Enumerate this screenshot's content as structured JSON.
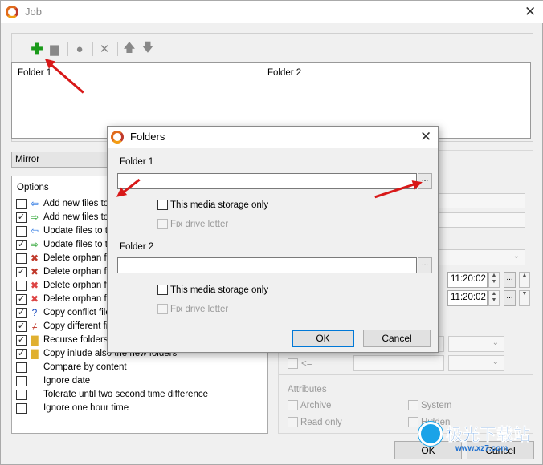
{
  "window": {
    "title": "Job"
  },
  "toolbar": {
    "add_icon": "plus-icon",
    "edit_icon": "edit-icon",
    "copy_icon": "copy-icon",
    "delete_icon": "x-icon",
    "up_icon": "arrow-up-icon",
    "down_icon": "arrow-down-icon"
  },
  "folder_list": {
    "columns": [
      "Folder 1",
      "Folder 2"
    ]
  },
  "sync_mode": {
    "value": "Mirror"
  },
  "options": {
    "title": "Options",
    "items": [
      {
        "label": "Add new files to th",
        "checked": false
      },
      {
        "label": "Add new files to th",
        "checked": true
      },
      {
        "label": "Update files to the",
        "checked": false
      },
      {
        "label": "Update files to the",
        "checked": true
      },
      {
        "label": "Delete orphan file",
        "checked": false
      },
      {
        "label": "Delete orphan file",
        "checked": true
      },
      {
        "label": "Delete orphan fol",
        "checked": false
      },
      {
        "label": "Delete orphan fol",
        "checked": true
      },
      {
        "label": "Copy conflict files",
        "checked": true
      },
      {
        "label": "Copy different file",
        "checked": true
      },
      {
        "label": "Recurse folders",
        "checked": true
      },
      {
        "label": "Copy inlude also the new folders",
        "checked": true
      },
      {
        "label": "Compare by content",
        "checked": false
      },
      {
        "label": "Ignore date",
        "checked": false
      },
      {
        "label": "Tolerate until two second time difference",
        "checked": false
      },
      {
        "label": "Ignore one hour time",
        "checked": false
      }
    ]
  },
  "filters": {
    "time1": "11:20:02",
    "time2": "11:20:02",
    "le_label": "<=",
    "attributes_title": "Attributes",
    "archive": "Archive",
    "system": "System",
    "read_only": "Read only",
    "hidden": "Hidden"
  },
  "main_buttons": {
    "ok": "OK",
    "cancel": "Cancel"
  },
  "dialog": {
    "title": "Folders",
    "folder1_label": "Folder 1",
    "folder1_value": "",
    "folder2_label": "Folder 2",
    "folder2_value": "",
    "browse": "...",
    "media_only": "This media storage only",
    "fix_drive": "Fix drive letter",
    "ok": "OK",
    "cancel": "Cancel"
  },
  "watermark": {
    "text": "极光下载站",
    "url": "www.xz7.com"
  },
  "colors": {
    "annotation_arrow": "#d81818",
    "accent": "#1d6fd0"
  }
}
